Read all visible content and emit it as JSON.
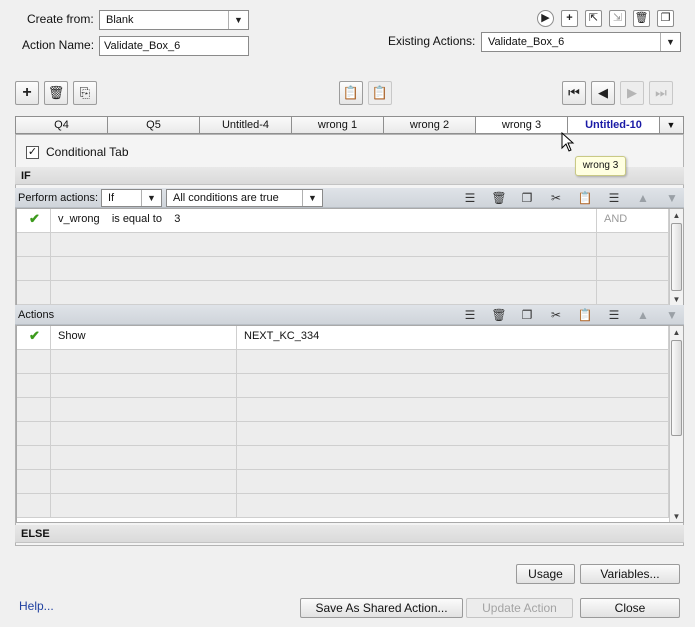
{
  "form": {
    "create_from_label": "Create from:",
    "create_from_value": "Blank",
    "action_name_label": "Action Name:",
    "action_name_value": "Validate_Box_6",
    "existing_actions_label": "Existing Actions:",
    "existing_actions_value": "Validate_Box_6"
  },
  "top_icons": [
    "play-icon",
    "add-icon",
    "import-icon",
    "export-icon",
    "delete-icon",
    "duplicate-icon"
  ],
  "tabs": {
    "items": [
      "Q4",
      "Q5",
      "Untitled-4",
      "wrong 1",
      "wrong 2",
      "wrong 3",
      "Untitled-10"
    ],
    "selected": "wrong 3",
    "current": "Untitled-10"
  },
  "tooltip": "wrong 3",
  "conditional": {
    "label": "Conditional Tab",
    "checked": true
  },
  "if_section": {
    "title": "IF",
    "perform_label": "Perform actions:",
    "perform_value": "If",
    "conditions_value": "All conditions are true",
    "rows": [
      {
        "status": "✔",
        "variable": "v_wrong",
        "operator": "is equal to",
        "value": "3",
        "logic": "AND"
      }
    ]
  },
  "actions_section": {
    "title": "Actions",
    "rows": [
      {
        "status": "✔",
        "action": "Show",
        "target": "NEXT_KC_334"
      }
    ]
  },
  "else_section": {
    "title": "ELSE"
  },
  "buttons": {
    "usage": "Usage",
    "variables": "Variables...",
    "save_shared": "Save As Shared Action...",
    "update": "Update Action",
    "close": "Close",
    "help": "Help..."
  }
}
